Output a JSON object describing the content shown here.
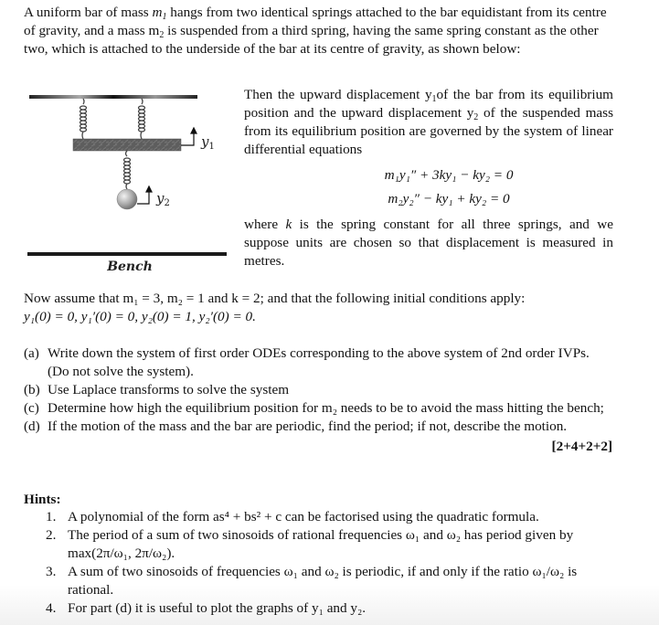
{
  "intro": {
    "line1_pre": "A uniform bar of mass ",
    "line1_post": " hangs from two identical springs attached to the bar equidistant from its centre of gravity, and a mass ",
    "line2_post": " is suspended from a third spring, having the same spring constant as the other two, which is attached to the underside of the bar at its centre of gravity, as shown below:",
    "m": "m",
    "sub1": "1",
    "sub2": "2"
  },
  "figure": {
    "label_y1": "y",
    "label_y1_sub": "1",
    "label_y2": "y",
    "label_y2_sub": "2",
    "bench_label": "Bench",
    "colors": {
      "ceiling": "#333333",
      "bar": "#5a5a5a",
      "spring": "#444444",
      "mass": "#9a9a9a",
      "bench": "#1a1a1a"
    }
  },
  "right_column": {
    "p1_a": "Then the upward displacement ",
    "p1_b": "of the bar from its equilibrium position and the upward displacement ",
    "p1_c": " of the suspended mass from its equilibrium position are governed by the system of linear differential equations",
    "y": "y",
    "equations": [
      "m₁y₁″ + 3ky₁ − ky₂ = 0",
      "m₂y₂″ − ky₁ + ky₂ = 0"
    ],
    "p2_a": "where ",
    "k": "k",
    "p2_b": " is the spring constant for all three springs, and we suppose units are chosen so that displacement is measured in metres."
  },
  "params": {
    "line1": "Now assume that m₁ = 3, m₂ = 1 and k = 2; and that the following initial conditions apply:",
    "line2": "y₁(0) = 0, y₁′(0) = 0, y₂(0) = 1,  y₂′(0) = 0."
  },
  "parts": [
    {
      "label": "(a)",
      "text": "Write down the system of first order ODEs corresponding to the above system of 2nd order IVPs. (Do not solve the system)."
    },
    {
      "label": "(b)",
      "text": "Use Laplace transforms to solve the system"
    },
    {
      "label": "(c)",
      "text": "Determine how high the equilibrium position for m₂ needs to be to avoid the mass hitting the bench;"
    },
    {
      "label": "(d)",
      "text": "If the motion of the mass and the bar are periodic, find the period; if not, describe the motion."
    }
  ],
  "marks": "[2+4+2+2]",
  "hints": {
    "title": "Hints:",
    "items": [
      {
        "num": "1.",
        "text": "A polynomial of the form as⁴ + bs² + c can be factorised using the quadratic formula."
      },
      {
        "num": "2.",
        "text": "The period of a sum of two sinosoids of rational frequencies ω₁ and ω₂ has period given by max(2π/ω₁, 2π/ω₂)."
      },
      {
        "num": "3.",
        "text": "A sum of two sinosoids of frequencies ω₁ and ω₂ is periodic, if and only if the ratio ω₁/ω₂ is rational."
      },
      {
        "num": "4.",
        "text": "For part (d) it is useful to plot the graphs of y₁ and y₂."
      }
    ]
  }
}
